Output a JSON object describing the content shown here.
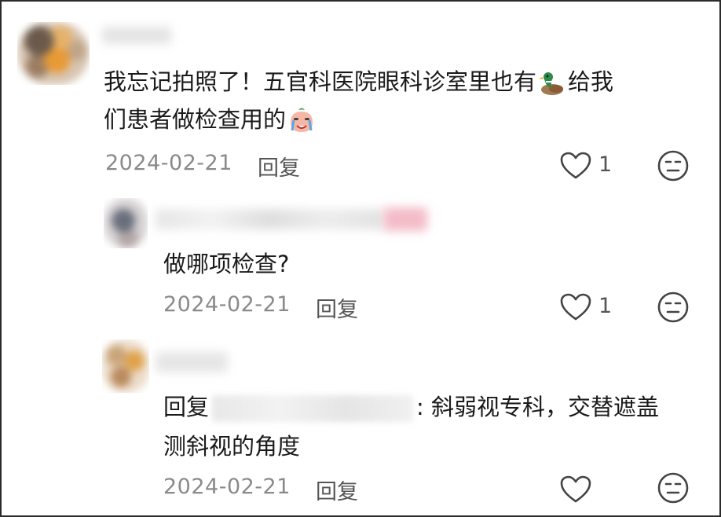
{
  "comments": [
    {
      "text_before": "我忘记拍照了！五官科医院眼科诊室里也有",
      "emoji_duck": "duck-emoji",
      "text_after": "给我",
      "text_line2": "们患者做检查用的",
      "emoji_cry": "crying-emoji",
      "date": "2024-02-21",
      "reply_label": "回复",
      "likes": "1"
    },
    {
      "text": "做哪项检查?",
      "date": "2024-02-21",
      "reply_label": "回复",
      "likes": "1"
    },
    {
      "reply_prefix": "回复",
      "text_line1": ": 斜弱视专科，交替遮盖",
      "text_line2": "测斜视的角度",
      "date": "2024-02-21",
      "reply_label": "回复",
      "likes": ""
    }
  ],
  "icons": {
    "like": "heart-outline-icon",
    "dislike": "dislike-face-icon"
  },
  "colors": {
    "text": "#1a1a1a",
    "date": "#8a8a8a",
    "icon": "#444444"
  }
}
